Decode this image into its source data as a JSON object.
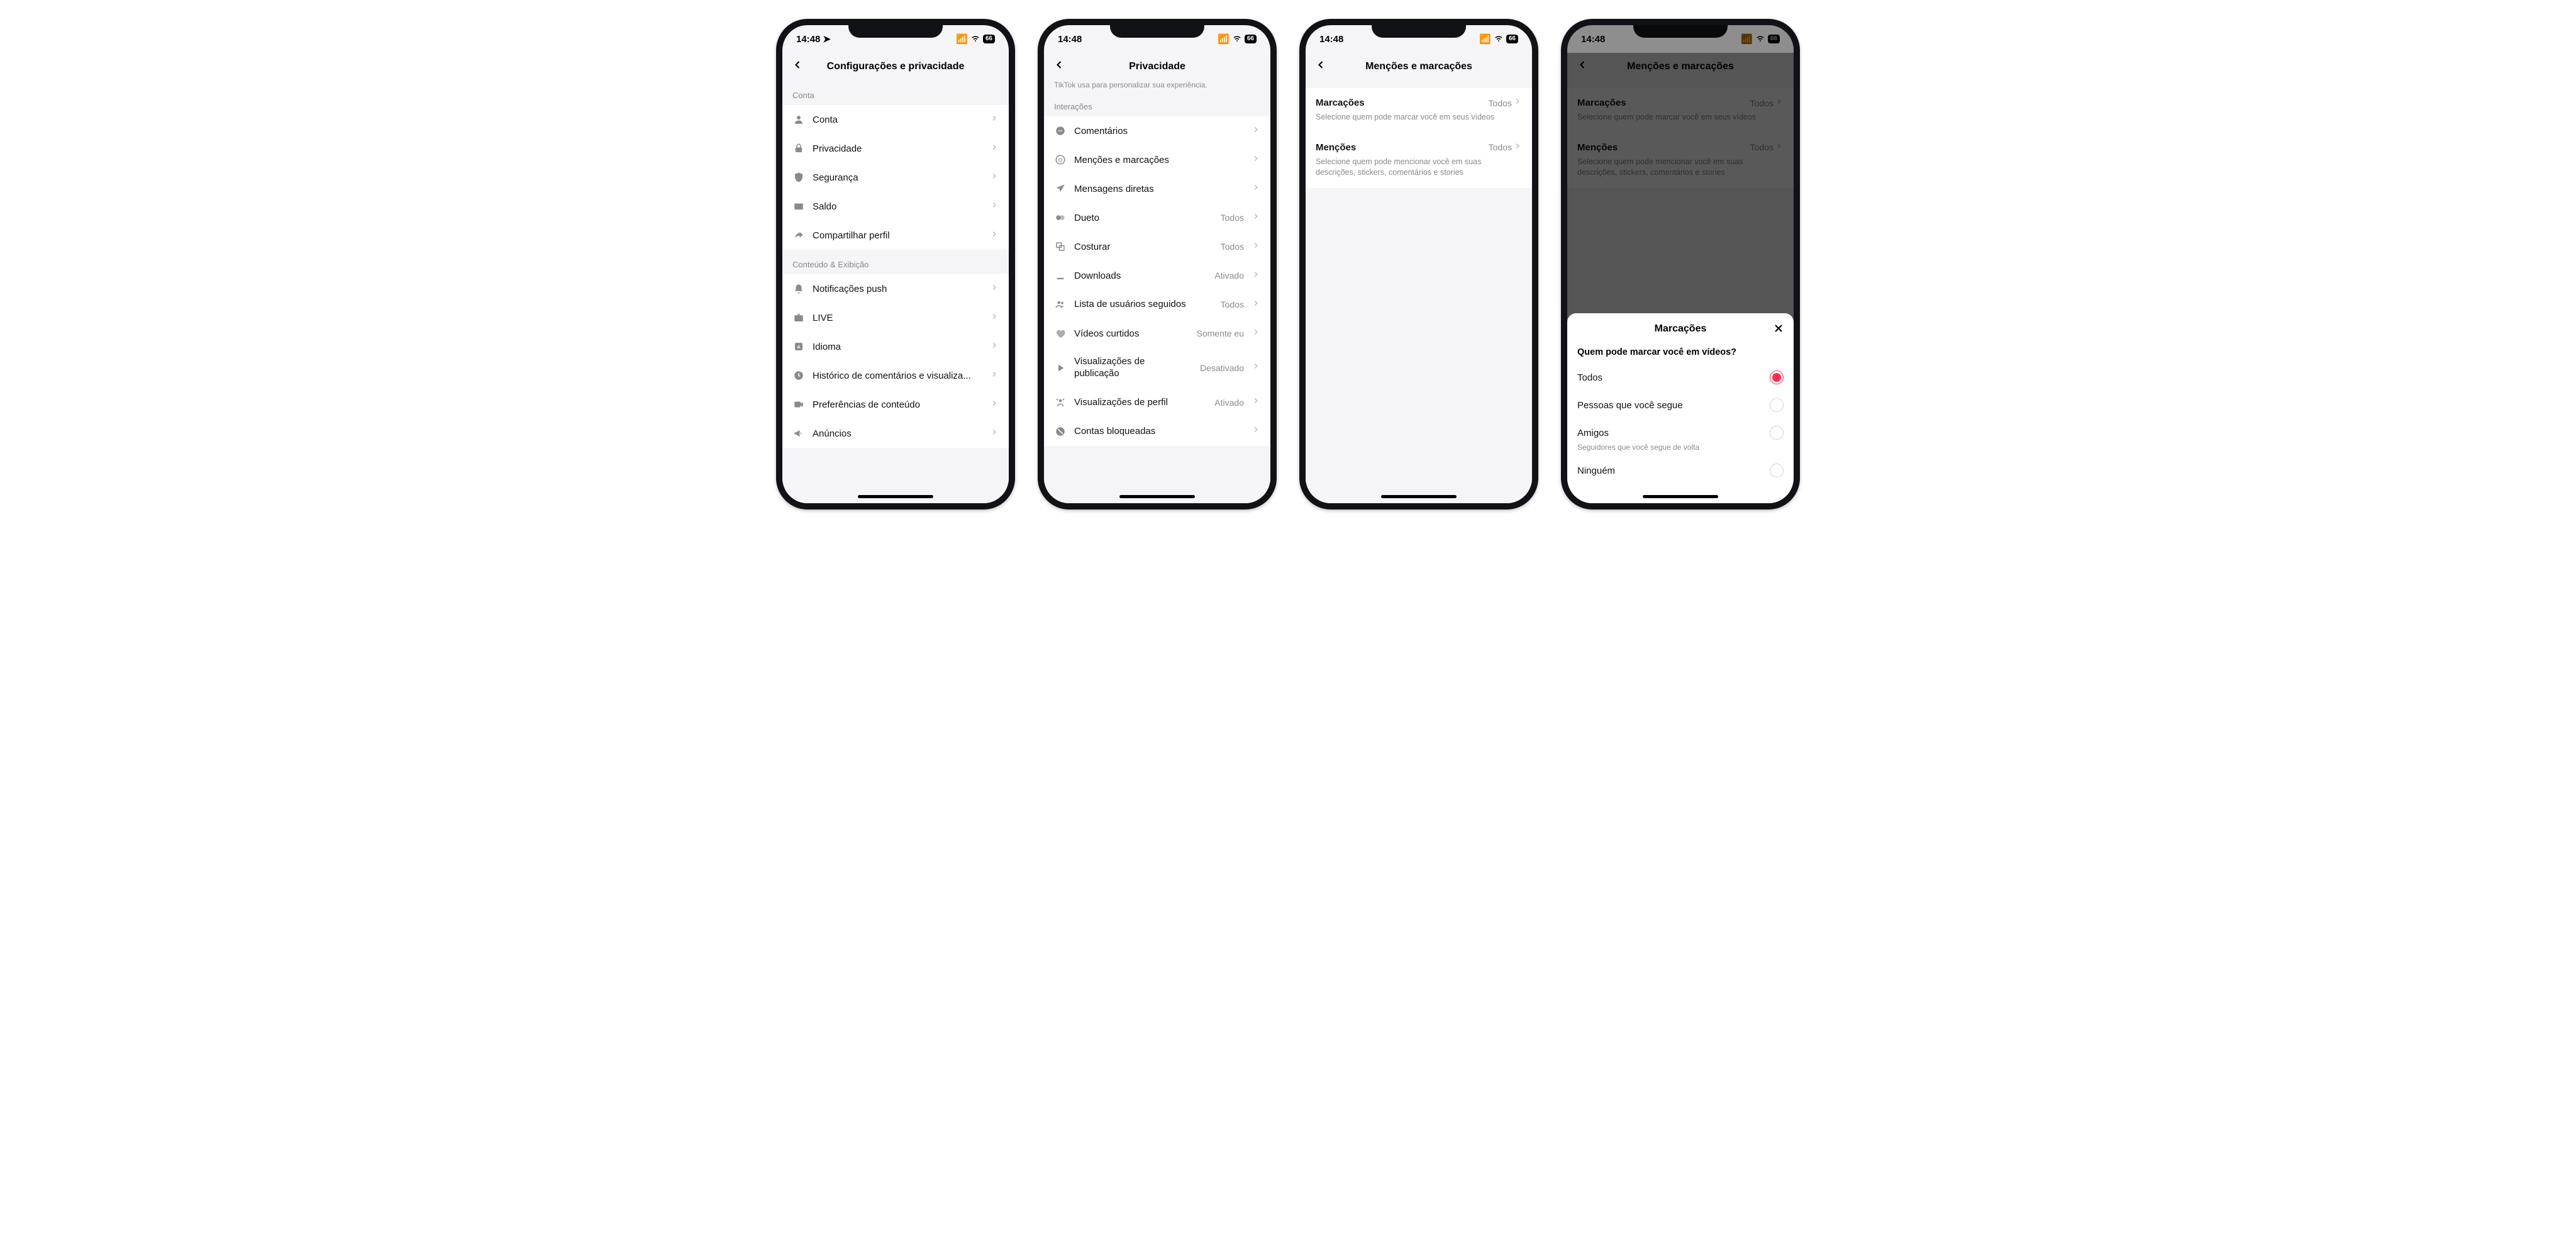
{
  "status": {
    "time": "14:48",
    "battery": "66"
  },
  "phone1": {
    "title": "Configurações e privacidade",
    "section1_header": "Conta",
    "rows1": [
      {
        "label": "Conta"
      },
      {
        "label": "Privacidade"
      },
      {
        "label": "Segurança"
      },
      {
        "label": "Saldo"
      },
      {
        "label": "Compartilhar perfil"
      }
    ],
    "section2_header": "Conteúdo & Exibição",
    "rows2": [
      {
        "label": "Notificações push"
      },
      {
        "label": "LIVE"
      },
      {
        "label": "Idioma"
      },
      {
        "label": "Histórico de comentários e visualiza..."
      },
      {
        "label": "Preferências de conteúdo"
      },
      {
        "label": "Anúncios"
      }
    ]
  },
  "phone2": {
    "title": "Privacidade",
    "partial": "TikTok usa para personalizar sua experiência.",
    "section_header": "Interações",
    "rows": [
      {
        "label": "Comentários",
        "value": ""
      },
      {
        "label": "Menções e marcações",
        "value": ""
      },
      {
        "label": "Mensagens diretas",
        "value": ""
      },
      {
        "label": "Dueto",
        "value": "Todos"
      },
      {
        "label": "Costurar",
        "value": "Todos"
      },
      {
        "label": "Downloads",
        "value": "Ativado"
      },
      {
        "label": "Lista de usuários seguidos",
        "value": "Todos"
      },
      {
        "label": "Vídeos curtidos",
        "value": "Somente eu"
      },
      {
        "label": "Visualizações de publicação",
        "value": "Desativado"
      },
      {
        "label": "Visualizações de perfil",
        "value": "Ativado"
      },
      {
        "label": "Contas bloqueadas",
        "value": ""
      }
    ]
  },
  "phone3": {
    "title": "Menções e marcações",
    "items": [
      {
        "title": "Marcações",
        "value": "Todos",
        "desc": "Selecione quem pode marcar você em seus vídeos"
      },
      {
        "title": "Menções",
        "value": "Todos",
        "desc": "Selecione quem pode mencionar você em suas descrições, stickers, comentários e stories"
      }
    ]
  },
  "phone4": {
    "title": "Menções e marcações",
    "items": [
      {
        "title": "Marcações",
        "value": "Todos",
        "desc": "Selecione quem pode marcar você em seus vídeos"
      },
      {
        "title": "Menções",
        "value": "Todos",
        "desc": "Selecione quem pode mencionar você em suas descrições, stickers, comentários e stories"
      }
    ],
    "sheet": {
      "title": "Marcações",
      "question": "Quem pode marcar você em vídeos?",
      "options": [
        {
          "label": "Todos",
          "selected": true
        },
        {
          "label": "Pessoas que você segue",
          "selected": false
        },
        {
          "label": "Amigos",
          "selected": false,
          "sub": "Seguidores que você segue de volta"
        },
        {
          "label": "Ninguém",
          "selected": false
        }
      ]
    }
  }
}
